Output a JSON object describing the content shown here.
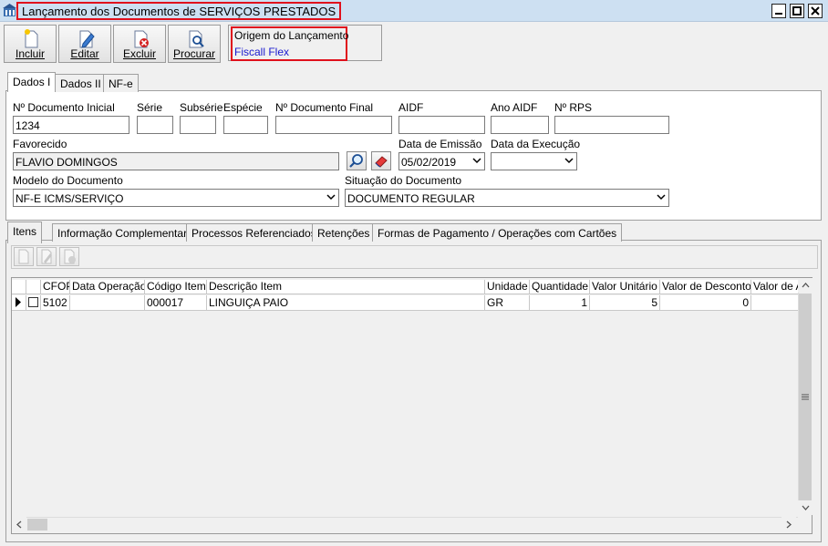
{
  "window": {
    "title": "Lançamento dos Documentos de SERVIÇOS PRESTADOS"
  },
  "toolbar": {
    "incluir": "Incluir",
    "editar": "Editar",
    "excluir": "Excluir",
    "procurar": "Procurar"
  },
  "origem": {
    "label": "Origem do Lançamento",
    "value": "Fiscall Flex"
  },
  "top_tabs": [
    "Dados I",
    "Dados II",
    "NF-e"
  ],
  "form": {
    "doc_inicial_label": "Nº Documento Inicial",
    "doc_inicial_value": "1234",
    "serie_label": "Série",
    "serie_value": "",
    "subserie_label": "Subsérie",
    "subserie_value": "",
    "especie_label": "Espécie",
    "especie_value": "",
    "doc_final_label": "Nº Documento Final",
    "doc_final_value": "",
    "aidf_label": "AIDF",
    "aidf_value": "",
    "ano_aidf_label": "Ano AIDF",
    "ano_aidf_value": "",
    "rps_label": "Nº RPS",
    "rps_value": "",
    "favorecido_label": "Favorecido",
    "favorecido_value": "FLAVIO DOMINGOS",
    "data_emissao_label": "Data de Emissão",
    "data_emissao_value": "05/02/2019",
    "data_execucao_label": "Data da Execução",
    "data_execucao_value": "",
    "modelo_label": "Modelo do Documento",
    "modelo_value": "NF-E ICMS/SERVIÇO",
    "situacao_label": "Situação do Documento",
    "situacao_value": "DOCUMENTO REGULAR"
  },
  "bottom_tabs": [
    "Itens",
    "Informação Complementar",
    "Processos Referenciados",
    "Retenções",
    "Formas de Pagamento / Operações com Cartões"
  ],
  "grid": {
    "columns": [
      "CFOP",
      "Data Operação",
      "Código Item",
      "Descrição Item",
      "Unidade",
      "Quantidade",
      "Valor Unitário",
      "Valor de Desconto",
      "Valor de A"
    ],
    "rows": [
      {
        "cfop": "5102",
        "data_operacao": "",
        "codigo": "000017",
        "descricao": "LINGUIÇA PAIO",
        "unidade": "GR",
        "quantidade": "1",
        "valor_unitario": "5",
        "valor_desconto": "0",
        "valor_a": ""
      }
    ]
  },
  "colors": {
    "title_highlight": "#e0101c",
    "origem_value": "#1a1ad0",
    "titlebar_bg": "#cde0f2"
  },
  "icons": [
    "app-icon",
    "minimize-icon",
    "maximize-icon",
    "close-icon",
    "new-document-icon",
    "edit-document-icon",
    "delete-document-icon",
    "search-document-icon",
    "search-icon",
    "eraser-icon",
    "dropdown-arrow-icon",
    "row-indicator-icon",
    "scroll-up-icon",
    "scroll-down-icon",
    "scroll-left-icon",
    "scroll-right-icon"
  ]
}
